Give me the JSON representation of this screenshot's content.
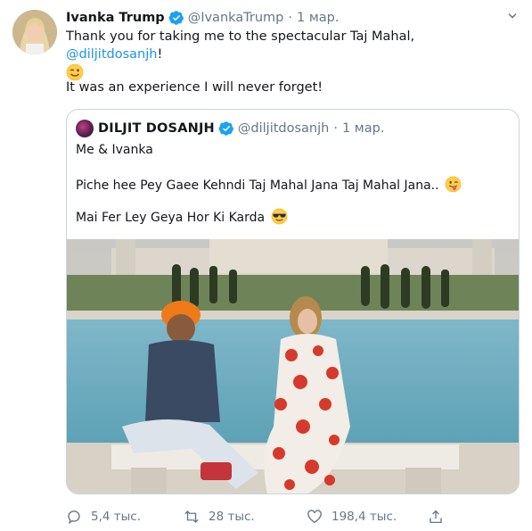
{
  "tweet": {
    "author_name": "Ivanka Trump",
    "author_handle": "@IvankaTrump",
    "separator": "·",
    "date": "1 мар.",
    "text_before_mention": "Thank you for taking me to the spectacular Taj Mahal, ",
    "mention": "@diljitdosanjh",
    "text_after_mention": "!",
    "emoji_1": "wink-face-icon",
    "paragraph_2": "It was an experience I will never forget!"
  },
  "quote": {
    "author_name": "DILJIT DOSANJH",
    "author_handle": "@diljitdosanjh",
    "separator": "·",
    "date": "1 мар.",
    "line_1": "Me & Ivanka",
    "line_2": "Piche hee Pey Gaee Kehndi Taj Mahal Jana Taj Mahal Jana..",
    "line_2_emoji": "tongue-wink-face-icon",
    "line_3": "Mai Fer Ley Geya Hor Ki Karda",
    "line_3_emoji": "sunglasses-face-icon"
  },
  "actions": {
    "replies": "5,4 тыс.",
    "retweets": "28 тыс.",
    "likes": "198,4 тыс."
  },
  "colors": {
    "link": "#1b95e0",
    "verified": "#1da1f2",
    "secondary_text": "#657786",
    "border": "#ccd6dd"
  }
}
